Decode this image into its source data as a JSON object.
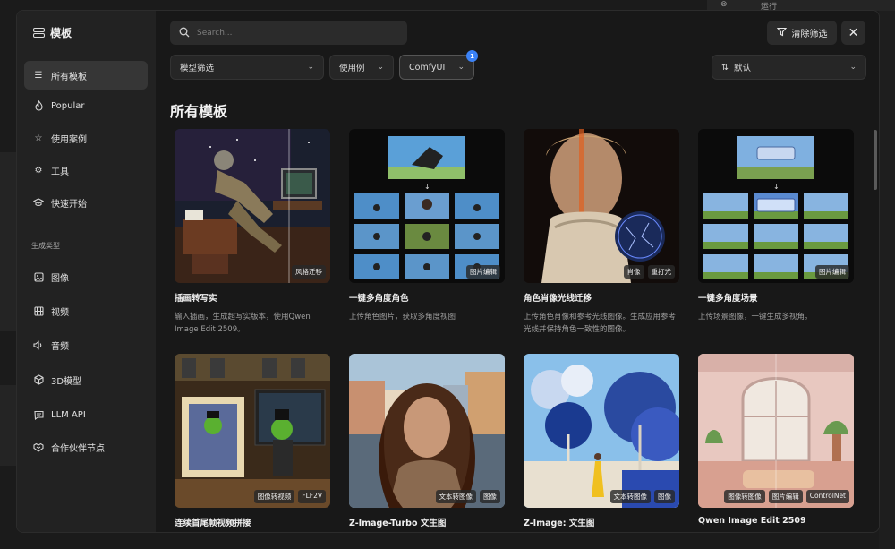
{
  "background": {
    "topbar_label": "运行"
  },
  "brand": {
    "title": "模板",
    "icon": "layout-grid-icon"
  },
  "sidebar": {
    "items": [
      {
        "label": "所有模板",
        "icon": "list-icon",
        "active": true
      },
      {
        "label": "Popular",
        "icon": "flame-icon"
      },
      {
        "label": "使用案例",
        "icon": "star-icon"
      },
      {
        "label": "工具",
        "icon": "gear-icon"
      },
      {
        "label": "快速开始",
        "icon": "graduation-cap-icon"
      }
    ],
    "section_label": "生成类型",
    "types": [
      {
        "label": "图像",
        "icon": "image-icon"
      },
      {
        "label": "视频",
        "icon": "film-icon"
      },
      {
        "label": "音频",
        "icon": "volume-icon"
      },
      {
        "label": "3D模型",
        "icon": "cube-icon"
      },
      {
        "label": "LLM API",
        "icon": "message-square-icon"
      },
      {
        "label": "合作伙伴节点",
        "icon": "handshake-icon"
      }
    ]
  },
  "toolbar": {
    "search_placeholder": "Search...",
    "clear_label": "清除筛选",
    "filters": [
      {
        "label": "模型筛选"
      },
      {
        "label": "使用例"
      },
      {
        "label": "ComfyUI",
        "badge": "1"
      }
    ],
    "sort_label": "默认"
  },
  "heading": "所有模板",
  "cards": [
    {
      "title": "插画转写实",
      "desc": "输入插画，生成超写实版本，使用Qwen Image Edit 2509。",
      "tags": [
        "风格迁移"
      ]
    },
    {
      "title": "一键多角度角色",
      "desc": "上传角色图片，获取多角度视图",
      "tags": [
        "图片编辑"
      ]
    },
    {
      "title": "角色肖像光线迁移",
      "desc": "上传角色肖像和参考光线图像。生成应用参考光线并保持角色一致性的图像。",
      "tags": [
        "肖像",
        "重打光"
      ]
    },
    {
      "title": "一键多角度场景",
      "desc": "上传场景图像，一键生成多视角。",
      "tags": [
        "图片编辑"
      ]
    },
    {
      "title": "连续首尾帧视频拼接",
      "desc": "",
      "tags": [
        "图像转视频",
        "FLF2V"
      ]
    },
    {
      "title": "Z-Image-Turbo 文生图",
      "desc": "",
      "tags": [
        "文本转图像",
        "图像"
      ]
    },
    {
      "title": "Z-Image: 文生图",
      "desc": "",
      "tags": [
        "文本转图像",
        "图像"
      ]
    },
    {
      "title": "Qwen Image Edit 2509",
      "desc": "",
      "tags": [
        "图像转图像",
        "图片编辑",
        "ControlNet"
      ]
    }
  ],
  "colors": {
    "accent": "#3b82f6",
    "panel": "#181818",
    "sidebar": "#222222"
  }
}
